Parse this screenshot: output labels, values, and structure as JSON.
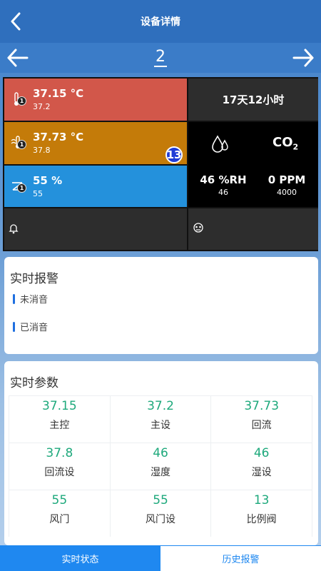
{
  "header": {
    "title": "设备详情"
  },
  "nav": {
    "page": "2"
  },
  "grid": {
    "temp1": {
      "main": "37.15 °C",
      "sub": "37.2",
      "badge": "1"
    },
    "temp2": {
      "main": "37.73 °C",
      "sub": "37.8",
      "badge": "1",
      "big_badge": "13"
    },
    "damper": {
      "main": "55 %",
      "sub": "55",
      "badge": "1"
    },
    "runtime": "17天12小时",
    "humidity": {
      "main": "46 %RH",
      "sub": "46"
    },
    "co2": {
      "label": "CO",
      "sub_label": "2",
      "main": "0 PPM",
      "sub": "4000"
    }
  },
  "alarms": {
    "title": "实时报警",
    "items": [
      "未消音",
      "已消音"
    ]
  },
  "params": {
    "title": "实时参数",
    "rows": [
      [
        {
          "value": "37.15",
          "label": "主控"
        },
        {
          "value": "37.2",
          "label": "主设"
        },
        {
          "value": "37.73",
          "label": "回流"
        }
      ],
      [
        {
          "value": "37.8",
          "label": "回流设"
        },
        {
          "value": "46",
          "label": "湿度"
        },
        {
          "value": "46",
          "label": "湿设"
        }
      ],
      [
        {
          "value": "55",
          "label": "风门"
        },
        {
          "value": "55",
          "label": "风门设"
        },
        {
          "value": "13",
          "label": "比例阀"
        }
      ]
    ]
  },
  "tabs": {
    "realtime": "实时状态",
    "history": "历史报警"
  },
  "colors": {
    "accent": "#1f88f0",
    "value_green": "#1ea97c",
    "red_cell": "#d2574a",
    "orange_cell": "#c47b09",
    "blue_cell": "#2491dc"
  }
}
